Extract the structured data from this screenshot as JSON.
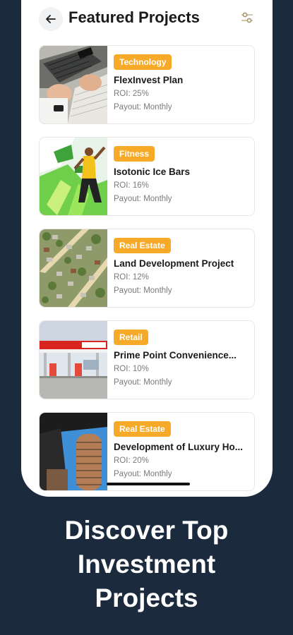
{
  "header": {
    "title": "Featured Projects"
  },
  "projects": [
    {
      "category": "Technology",
      "name": "FlexInvest Plan",
      "roi": "ROI: 25%",
      "payout": "Payout: Monthly"
    },
    {
      "category": "Fitness",
      "name": "Isotonic Ice Bars",
      "roi": "ROI: 16%",
      "payout": "Payout: Monthly"
    },
    {
      "category": "Real Estate",
      "name": "Land Development Project",
      "roi": "ROI: 12%",
      "payout": "Payout: Monthly"
    },
    {
      "category": "Retail",
      "name": "Prime Point Convenience...",
      "roi": "ROI: 10%",
      "payout": "Payout: Monthly"
    },
    {
      "category": "Real Estate",
      "name": "Development of Luxury Ho...",
      "roi": "ROI: 20%",
      "payout": "Payout: Monthly"
    }
  ],
  "caption": {
    "line1": "Discover Top",
    "line2": "Investment",
    "line3": "Projects"
  },
  "colors": {
    "background": "#1c2a3d",
    "badge": "#f7a928"
  }
}
